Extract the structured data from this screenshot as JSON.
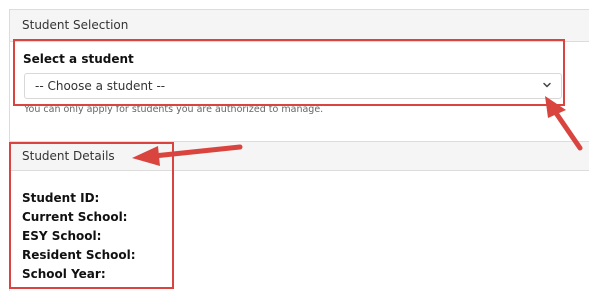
{
  "student_selection": {
    "header_title": "Student Selection",
    "select_label": "Select a student",
    "select_value": "-- Choose a student --",
    "help_text": "You can only apply for students you are authorized to manage."
  },
  "student_details": {
    "header_title": "Student Details",
    "fields": [
      "Student ID:",
      "Current School:",
      "ESY School:",
      "Resident School:",
      "School Year:"
    ]
  },
  "annotation": {
    "highlight_color": "#d9453e"
  }
}
